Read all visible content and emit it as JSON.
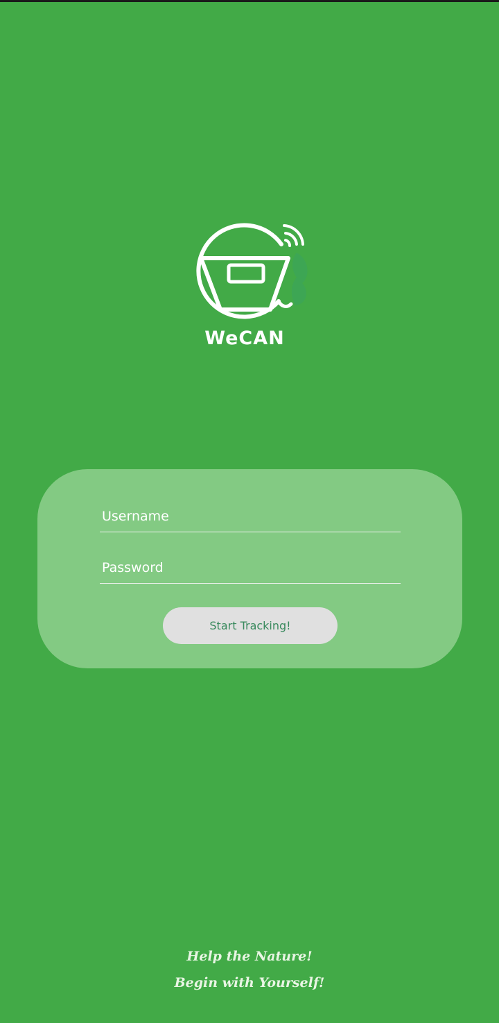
{
  "app": {
    "name": "WeCAN"
  },
  "colors": {
    "background": "#42AA47",
    "card": "#83CA83",
    "button_bg": "#E0E0E0",
    "button_text": "#3A8A5E",
    "slogan_text": "#E9F5E4"
  },
  "logo": {
    "icon": "wecan-bin-wifi-icon",
    "text": "WeCAN"
  },
  "login": {
    "username_placeholder": "Username",
    "username_value": "",
    "password_placeholder": "Password",
    "password_value": "",
    "submit_label": "Start Tracking!"
  },
  "footer": {
    "line1": "Help the Nature!",
    "line2": "Begin with Yourself!"
  }
}
